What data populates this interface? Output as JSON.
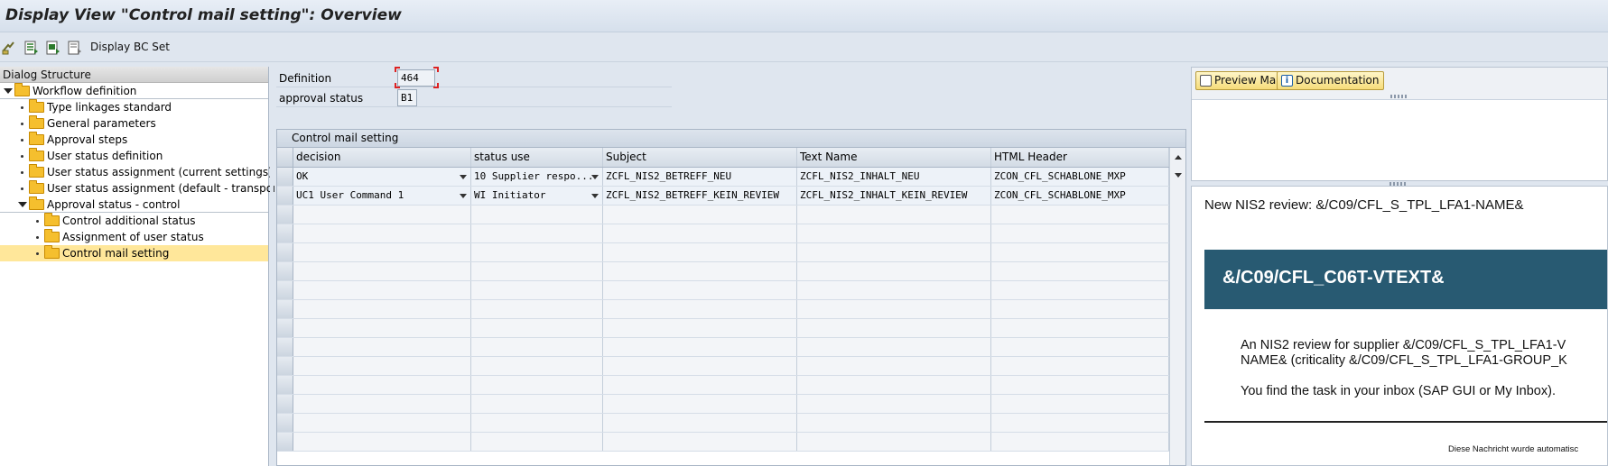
{
  "title": "Display View \"Control mail setting\": Overview",
  "toolbar": {
    "icons": [
      "change-display-icon",
      "select-all-icon",
      "select-block-icon",
      "deselect-icon"
    ],
    "display_bc_set": "Display BC Set"
  },
  "dialog_structure": {
    "header": "Dialog Structure",
    "items": [
      {
        "label": "Workflow definition",
        "level": 0,
        "expanded": true
      },
      {
        "label": "Type linkages standard",
        "level": 1
      },
      {
        "label": "General parameters",
        "level": 1
      },
      {
        "label": "Approval steps",
        "level": 1
      },
      {
        "label": "User status definition",
        "level": 1
      },
      {
        "label": "User status assignment (current settings)",
        "level": 1
      },
      {
        "label": "User status assignment (default - transport)",
        "level": 1
      },
      {
        "label": "Approval status - control",
        "level": 1,
        "expanded": true
      },
      {
        "label": "Control additional status",
        "level": 2
      },
      {
        "label": "Assignment of user status",
        "level": 2
      },
      {
        "label": "Control mail setting",
        "level": 2,
        "selected": true
      }
    ]
  },
  "fields": {
    "definition_label": "Definition",
    "definition_value": "464",
    "approval_status_label": "approval status",
    "approval_status_value": "B1"
  },
  "table": {
    "caption": "Control mail setting",
    "columns": [
      "decision",
      "status use",
      "Subject",
      "Text Name",
      "HTML Header"
    ],
    "rows": [
      [
        "OK",
        "10 Supplier respo...",
        "ZCFL_NIS2_BETREFF_NEU",
        "ZCFL_NIS2_INHALT_NEU",
        "ZCON_CFL_SCHABLONE_MXP"
      ],
      [
        "UC1 User Command 1",
        "WI Initiator",
        "ZCFL_NIS2_BETREFF_KEIN_REVIEW",
        "ZCFL_NIS2_INHALT_KEIN_REVIEW",
        "ZCON_CFL_SCHABLONE_MXP"
      ]
    ]
  },
  "preview": {
    "preview_mail_button": "Preview Mail",
    "documentation_button": "Documentation",
    "subject": "New NIS2 review: &/C09/CFL_S_TPL_LFA1-NAME&",
    "banner": "&/C09/CFL_C06T-VTEXT&",
    "body_line1": "An NIS2 review for supplier &/C09/CFL_S_TPL_LFA1-V",
    "body_line2": "NAME& (criticality &/C09/CFL_S_TPL_LFA1-GROUP_K",
    "body_line3": "You find the task in your inbox (SAP GUI or My Inbox).",
    "footer": "Diese Nachricht wurde automatisc",
    "banner_color": "#285a72"
  }
}
